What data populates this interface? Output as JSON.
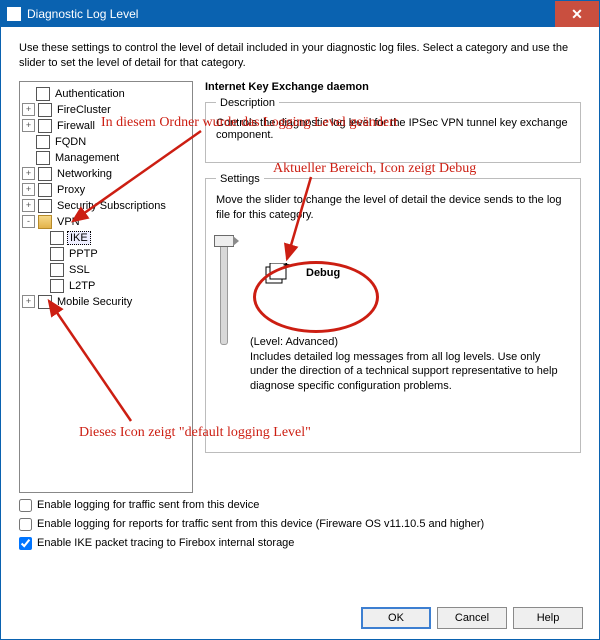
{
  "window": {
    "title": "Diagnostic Log Level"
  },
  "intro": "Use these settings to control the level of detail included in your diagnostic log files. Select a category and use the slider to set the level of detail for that category.",
  "tree": {
    "items": [
      {
        "label": "Authentication",
        "exp": "",
        "icon": "doc"
      },
      {
        "label": "FireCluster",
        "exp": "+",
        "icon": "doc"
      },
      {
        "label": "Firewall",
        "exp": "+",
        "icon": "doc"
      },
      {
        "label": "FQDN",
        "exp": "",
        "icon": "doc"
      },
      {
        "label": "Management",
        "exp": "",
        "icon": "doc"
      },
      {
        "label": "Networking",
        "exp": "+",
        "icon": "doc"
      },
      {
        "label": "Proxy",
        "exp": "+",
        "icon": "doc"
      },
      {
        "label": "Security Subscriptions",
        "exp": "+",
        "icon": "doc"
      },
      {
        "label": "VPN",
        "exp": "-",
        "icon": "fold"
      },
      {
        "label": "IKE",
        "exp": "",
        "icon": "doc",
        "indent": 1,
        "selected": true
      },
      {
        "label": "PPTP",
        "exp": "",
        "icon": "doc",
        "indent": 1
      },
      {
        "label": "SSL",
        "exp": "",
        "icon": "doc",
        "indent": 1
      },
      {
        "label": "L2TP",
        "exp": "",
        "icon": "doc",
        "indent": 1
      },
      {
        "label": "Mobile Security",
        "exp": "+",
        "icon": "doc"
      }
    ]
  },
  "detail": {
    "title": "Internet Key Exchange daemon",
    "description_legend": "Description",
    "description_text": "Controls the diagnostic log level for the IPSec VPN tunnel key exchange component.",
    "settings_legend": "Settings",
    "settings_msg": "Move the slider to change the level of detail the device sends to the log file for this category.",
    "level_name": "Debug",
    "level_caption": "(Level: Advanced)",
    "level_desc": "Includes detailed log messages from all log levels. Use only under the direction of a technical support representative to help diagnose specific configuration problems."
  },
  "checks": {
    "c1": "Enable logging for traffic sent from this device",
    "c2": "Enable logging for reports for traffic sent from this device (Fireware OS v11.10.5 and higher)",
    "c3": "Enable IKE packet tracing to Firebox internal storage",
    "c1_checked": false,
    "c2_checked": false,
    "c3_checked": true
  },
  "buttons": {
    "ok": "OK",
    "cancel": "Cancel",
    "help": "Help"
  },
  "annotations": {
    "a1": "In diesem Ordner wurde das Logging Level geändert",
    "a2": "Aktueller Bereich, Icon zeigt Debug",
    "a3": "Dieses Icon zeigt \"default logging Level\""
  }
}
